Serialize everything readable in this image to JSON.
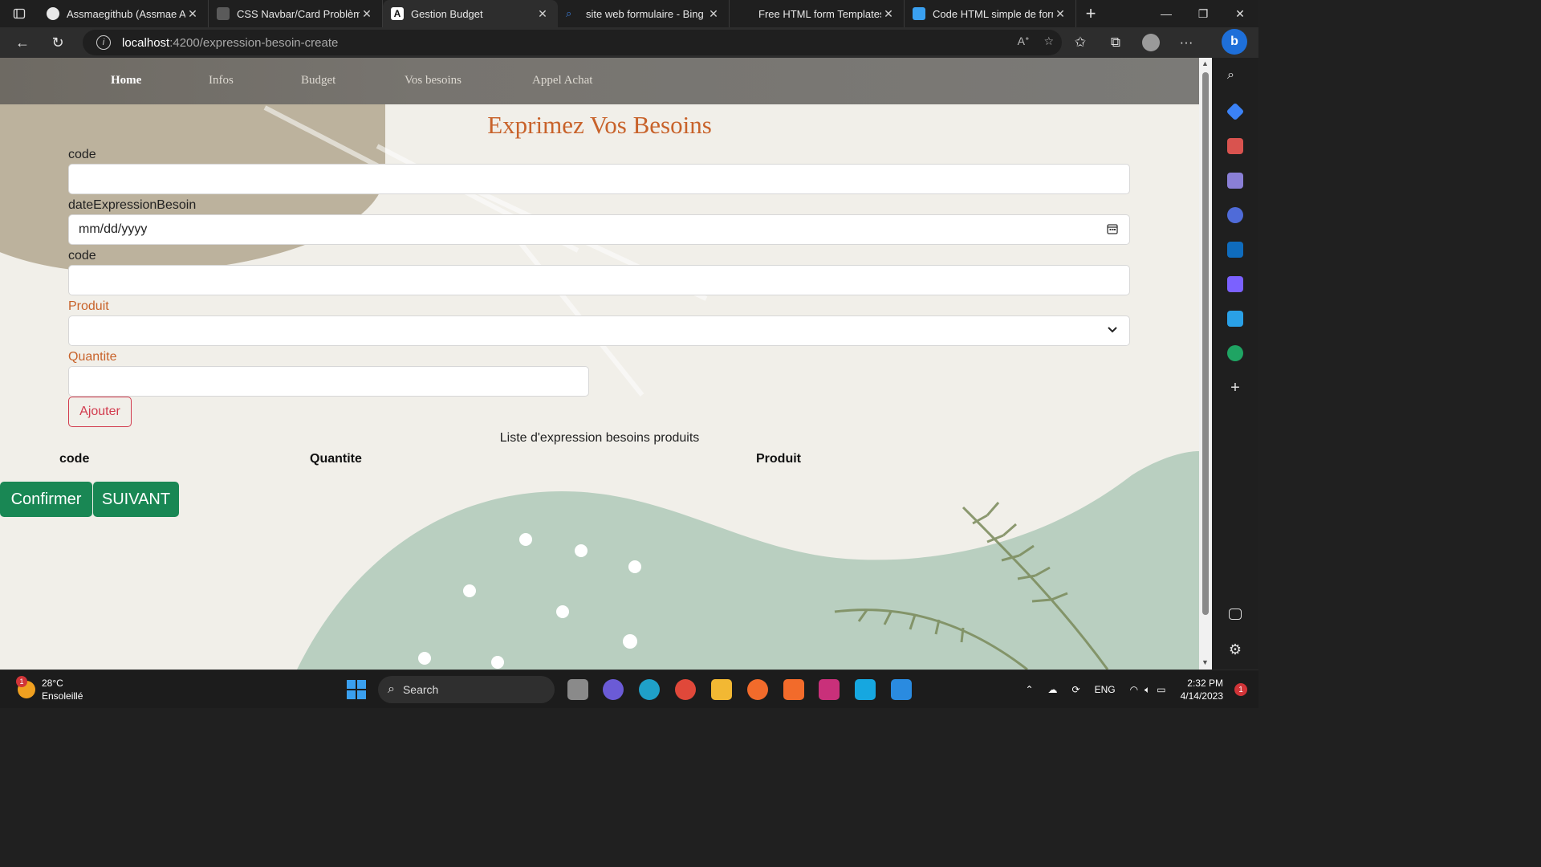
{
  "browser": {
    "tabs": [
      {
        "title": "Assmaegithub (Assmae Alic",
        "favicon_color": "#e8e8e8",
        "active": false
      },
      {
        "title": "CSS Navbar/Card Problème",
        "favicon_color": "#5a5a5a",
        "active": false
      },
      {
        "title": "Gestion Budget",
        "favicon_color": "#ffffff",
        "active": true
      },
      {
        "title": "site web formulaire - Bing in",
        "favicon_color": "#3a7bd5",
        "active": false
      },
      {
        "title": "Free HTML form Templates",
        "favicon_color": "#1f1f1f",
        "active": false
      },
      {
        "title": "Code HTML simple de form",
        "favicon_color": "#3aa0f0",
        "active": false
      }
    ],
    "address": {
      "host": "localhost",
      "path": ":4200/expression-besoin-create"
    },
    "bing_label": "b"
  },
  "page": {
    "nav": {
      "home": "Home",
      "infos": "Infos",
      "budget": "Budget",
      "besoins": "Vos besoins",
      "appel": "Appel Achat"
    },
    "title": "Exprimez Vos Besoins",
    "form": {
      "code_label": "code",
      "date_label": "dateExpressionBesoin",
      "date_placeholder": "mm/dd/yyyy",
      "code2_label": "code",
      "produit_label": "Produit",
      "quantite_label": "Quantite",
      "ajouter_label": "Ajouter"
    },
    "list": {
      "title": "Liste d'expression besoins produits",
      "columns": [
        "code",
        "Quantite",
        "Produit"
      ]
    },
    "buttons": {
      "confirmer": "Confirmer",
      "suivant": "SUIVANT"
    },
    "colors": {
      "accent_orange": "#c8622a",
      "danger": "#d23b4e",
      "success": "#198754"
    }
  },
  "taskbar": {
    "weather": {
      "temp": "28°C",
      "condition": "Ensoleillé",
      "badge": "1"
    },
    "search_label": "Search",
    "lang": "ENG",
    "time": "2:32 PM",
    "date": "4/14/2023",
    "notif_count": "1"
  }
}
